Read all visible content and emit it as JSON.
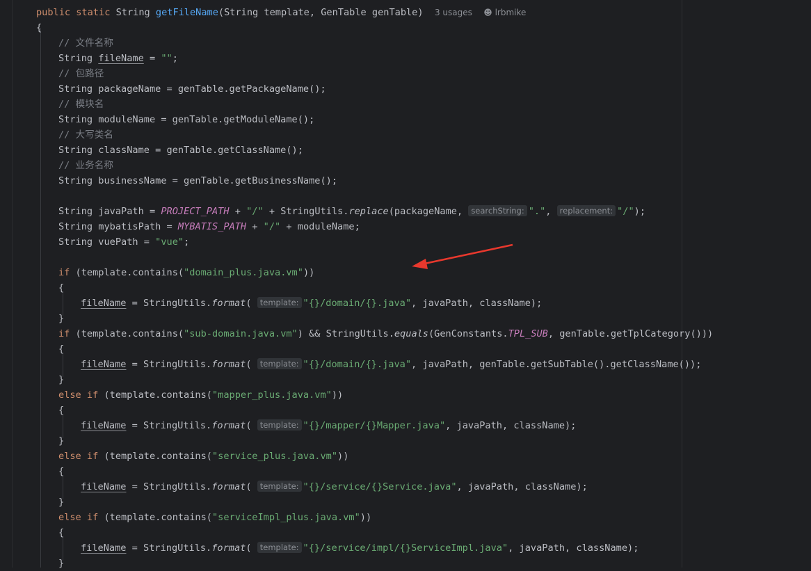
{
  "editor": {
    "signature": {
      "kw1": "public",
      "kw2": "static",
      "type": "String",
      "method": "getFileName",
      "params": "(String template, GenTable genTable)",
      "usages": "3 usages",
      "author": "lrbmike"
    },
    "open_brace": "{",
    "lines": {
      "c1": "// 文件名称",
      "l1_type": "String ",
      "l1_field": "fileName",
      "l1_op": " = ",
      "l1_str": "\"\"",
      "l1_end": ";",
      "c2": "// 包路径",
      "l2": "String packageName = genTable.getPackageName();",
      "c3": "// 模块名",
      "l3": "String moduleName = genTable.getModuleName();",
      "c4": "// 大写类名",
      "l4": "String className = genTable.getClassName();",
      "c5": "// 业务名称",
      "l5": "String businessName = genTable.getBusinessName();",
      "jp_a": "String javaPath = ",
      "jp_const": "PROJECT_PATH",
      "jp_b": " + ",
      "jp_s1": "\"/\"",
      "jp_c": " + StringUtils.",
      "jp_m": "replace",
      "jp_d": "(packageName, ",
      "jp_h1": "searchString:",
      "jp_s2": "\".\"",
      "jp_e": ", ",
      "jp_h2": "replacement:",
      "jp_s3": "\"/\"",
      "jp_f": ");",
      "mp_a": "String mybatisPath = ",
      "mp_const": "MYBATIS_PATH",
      "mp_b": " + ",
      "mp_s1": "\"/\"",
      "mp_c": " + moduleName;",
      "vp_a": "String vuePath = ",
      "vp_s": "\"vue\"",
      "vp_b": ";",
      "if1_kw": "if",
      "if1_a": " (template.contains(",
      "if1_s": "\"domain_plus.java.vm\"",
      "if1_b": "))",
      "ob": "{",
      "cb": "}",
      "fn_field": "fileName",
      "fn_eq": " = StringUtils.",
      "fn_m": "format",
      "fn_p": "(",
      "fn_hint": "template:",
      "b1_s": "\"{}/domain/{}.java\"",
      "b1_r": ", javaPath, className);",
      "if2_kw": "if",
      "if2_a": " (template.contains(",
      "if2_s": "\"sub-domain.java.vm\"",
      "if2_b": ") && StringUtils.",
      "if2_m": "equals",
      "if2_c": "(GenConstants.",
      "if2_const": "TPL_SUB",
      "if2_d": ", genTable.getTplCategory()))",
      "b2_s": "\"{}/domain/{}.java\"",
      "b2_r": ", javaPath, genTable.getSubTable().getClassName());",
      "else_kw": "else if",
      "if3_a": " (template.contains(",
      "if3_s": "\"mapper_plus.java.vm\"",
      "if3_b": "))",
      "b3_s": "\"{}/mapper/{}Mapper.java\"",
      "b3_r": ", javaPath, className);",
      "if4_a": " (template.contains(",
      "if4_s": "\"service_plus.java.vm\"",
      "if4_b": "))",
      "b4_s": "\"{}/service/{}Service.java\"",
      "b4_r": ", javaPath, className);",
      "if5_a": " (template.contains(",
      "if5_s": "\"serviceImpl_plus.java.vm\"",
      "if5_b": "))",
      "b5_s": "\"{}/service/impl/{}ServiceImpl.java\"",
      "b5_r": ", javaPath, className);"
    },
    "colors": {
      "background": "#1e1f22",
      "keyword": "#cf8e6d",
      "method": "#56a8f5",
      "string": "#6aab73",
      "comment": "#7a7e85",
      "constant": "#c77dbb",
      "arrow": "#e8382d"
    }
  }
}
